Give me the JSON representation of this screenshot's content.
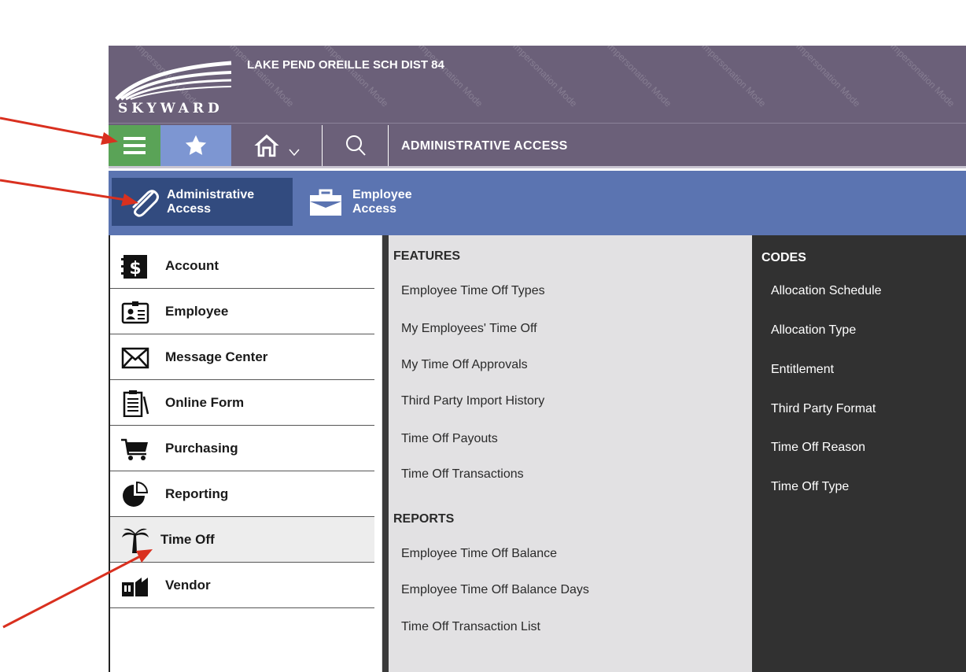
{
  "header": {
    "logo_text": "SKYWARD",
    "district": "LAKE PEND OREILLE SCH DIST 84",
    "watermark_text": "Impersonation Mode"
  },
  "toolbar": {
    "menu_icon": "hamburger-icon",
    "favorites_icon": "star-icon",
    "home_icon": "home-icon",
    "home_menu_icon": "chevron-down-icon",
    "search_icon": "search-icon",
    "title": "ADMINISTRATIVE ACCESS"
  },
  "access": {
    "tabs": [
      {
        "line1": "Administrative",
        "line2": "Access",
        "icon": "paperclip-icon",
        "selected": true
      },
      {
        "line1": "Employee",
        "line2": "Access",
        "icon": "briefcase-icon",
        "selected": false
      }
    ]
  },
  "nav": {
    "items": [
      {
        "label": "Account",
        "icon": "dollar-icon"
      },
      {
        "label": "Employee",
        "icon": "id-card-icon"
      },
      {
        "label": "Message Center",
        "icon": "envelope-icon"
      },
      {
        "label": "Online Form",
        "icon": "clipboard-icon"
      },
      {
        "label": "Purchasing",
        "icon": "cart-icon"
      },
      {
        "label": "Reporting",
        "icon": "pie-chart-icon"
      },
      {
        "label": "Time Off",
        "icon": "palm-tree-icon",
        "selected": true
      },
      {
        "label": "Vendor",
        "icon": "factory-icon"
      }
    ]
  },
  "features": {
    "heading": "FEATURES",
    "items": [
      "Employee Time Off Types",
      "My Employees' Time Off",
      "My Time Off Approvals",
      "Third Party Import History",
      "Time Off Payouts",
      "Time Off Transactions"
    ]
  },
  "reports": {
    "heading": "REPORTS",
    "items": [
      "Employee Time Off Balance",
      "Employee Time Off Balance Days",
      "Time Off Transaction List"
    ]
  },
  "codes": {
    "heading": "CODES",
    "items": [
      "Allocation Schedule",
      "Allocation Type",
      "Entitlement",
      "Third Party Format",
      "Time Off Reason",
      "Time Off Type"
    ]
  },
  "colors": {
    "header_bg": "#6b6079",
    "menu_green": "#5aa357",
    "star_blue": "#7d96d2",
    "access_bar": "#5b74b1",
    "access_selected": "#324b7f",
    "codes_bg": "#313131",
    "arrow_red": "#d9301f"
  }
}
